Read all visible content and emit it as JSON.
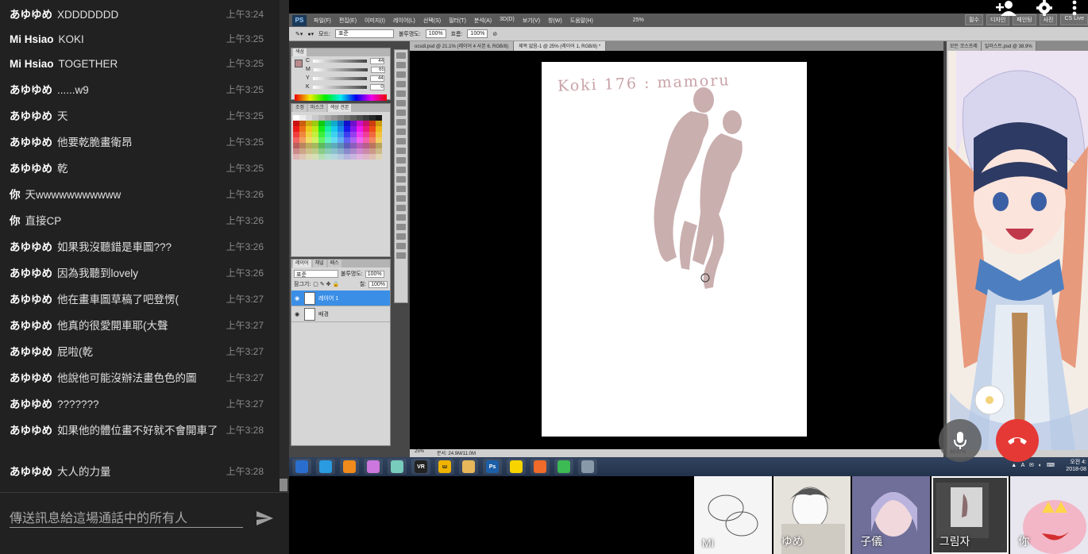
{
  "chat": {
    "messages": [
      {
        "sender": "あゆゆめ",
        "text": "XDDDDDDD",
        "time": "上午3:24"
      },
      {
        "sender": "Mi Hsiao",
        "text": "KOKI",
        "time": "上午3:25"
      },
      {
        "sender": "Mi Hsiao",
        "text": "TOGETHER",
        "time": "上午3:25"
      },
      {
        "sender": "あゆゆめ",
        "text": "......w9",
        "time": "上午3:25"
      },
      {
        "sender": "あゆゆめ",
        "text": "天",
        "time": "上午3:25"
      },
      {
        "sender": "あゆゆめ",
        "text": "他要乾脆畫衛昂",
        "time": "上午3:25"
      },
      {
        "sender": "あゆゆめ",
        "text": "乾",
        "time": "上午3:25"
      },
      {
        "sender": "你",
        "text": "天wwwwwwwwwww",
        "time": "上午3:26"
      },
      {
        "sender": "你",
        "text": "直接CP",
        "time": "上午3:26"
      },
      {
        "sender": "あゆゆめ",
        "text": "如果我沒聽錯是車圖???",
        "time": "上午3:26"
      },
      {
        "sender": "あゆゆめ",
        "text": "因為我聽到lovely",
        "time": "上午3:26"
      },
      {
        "sender": "あゆゆめ",
        "text": "他在畫車圖草稿了吧登愣(",
        "time": "上午3:27"
      },
      {
        "sender": "あゆゆめ",
        "text": "他真的很愛開車耶(大聲",
        "time": "上午3:27"
      },
      {
        "sender": "あゆゆめ",
        "text": "屁啦(乾",
        "time": "上午3:27"
      },
      {
        "sender": "あゆゆめ",
        "text": "他說他可能沒辦法畫色色的圖",
        "time": "上午3:27"
      },
      {
        "sender": "あゆゆめ",
        "text": "???????",
        "time": "上午3:27"
      },
      {
        "sender": "あゆゆめ",
        "text": "如果他的體位畫不好就不會開車了",
        "time": "上午3:28"
      },
      {
        "sender": "あゆゆめ",
        "text": "大人的力量",
        "time": "上午3:28"
      }
    ],
    "composer_placeholder": "傳送訊息給這場通話中的所有人"
  },
  "photoshop": {
    "logo": "PS",
    "menu": [
      "파일(F)",
      "편집(E)",
      "이미지(I)",
      "레이어(L)",
      "선택(S)",
      "필터(T)",
      "분석(A)",
      "3D(D)",
      "보기(V)",
      "창(W)",
      "도움말(H)"
    ],
    "zoom_box": "25%",
    "workspaces": [
      "필수",
      "디자인",
      "페인팅",
      "사진",
      "CS Live"
    ],
    "options": {
      "mode_label": "모드:",
      "mode": "표준",
      "opacity_label": "불투명도:",
      "opacity": "100%",
      "flow_label": "흐름:",
      "flow": "100%"
    },
    "color_panel": {
      "tabs": [
        "색상"
      ],
      "channels": [
        {
          "k": "C",
          "v": "44"
        },
        {
          "k": "M",
          "v": "65"
        },
        {
          "k": "Y",
          "v": "44"
        },
        {
          "k": "K",
          "v": "0"
        }
      ]
    },
    "swatch_tabs": [
      "조정",
      "마스크",
      "색상 견본"
    ],
    "layers_panel": {
      "tabs": [
        "레이어",
        "채널",
        "패스"
      ],
      "blend": "표준",
      "opacity_label": "불투명도:",
      "opacity": "100%",
      "lock_label": "잠그기:",
      "fill_label": "칠:",
      "fill": "100%",
      "layers": [
        {
          "name": "레이어 1",
          "selected": true
        },
        {
          "name": "배경",
          "selected": false
        }
      ]
    },
    "doc_tabs": [
      "ocsdl.psd @ 21.1% (레이어 4 사본 6, RGB/8)",
      "제목 없음-1 @ 25% (레이어 1, RGB/8) *"
    ],
    "canvas_text": "Koki 176 : mamoru",
    "status_zoom": "25%",
    "status_doc": "문서: 24.9M/11.0M",
    "ref_tabs": [
      "모든 코스프레",
      "일러스트.psd @ 38.9%"
    ],
    "ref_zoom": "38.97%"
  },
  "taskbar": {
    "apps": [
      "start",
      "ie",
      "media",
      "paint",
      "notes",
      "VR",
      "ɯ",
      "folder",
      "Ps",
      "talk",
      "orange",
      "chrome",
      "shield"
    ],
    "clock_line1": "오전 4:",
    "clock_line2": "2018-08"
  },
  "call": {
    "top_icons": [
      "add-person-icon",
      "gear-icon",
      "more-vert-icon"
    ],
    "participants": [
      {
        "name": "Mi"
      },
      {
        "name": "ゆめ"
      },
      {
        "name": "子儀"
      },
      {
        "name": "그림자"
      },
      {
        "name": "你"
      }
    ],
    "colors": {
      "hangup": "#e53935",
      "chat_bg": "#212121"
    }
  }
}
